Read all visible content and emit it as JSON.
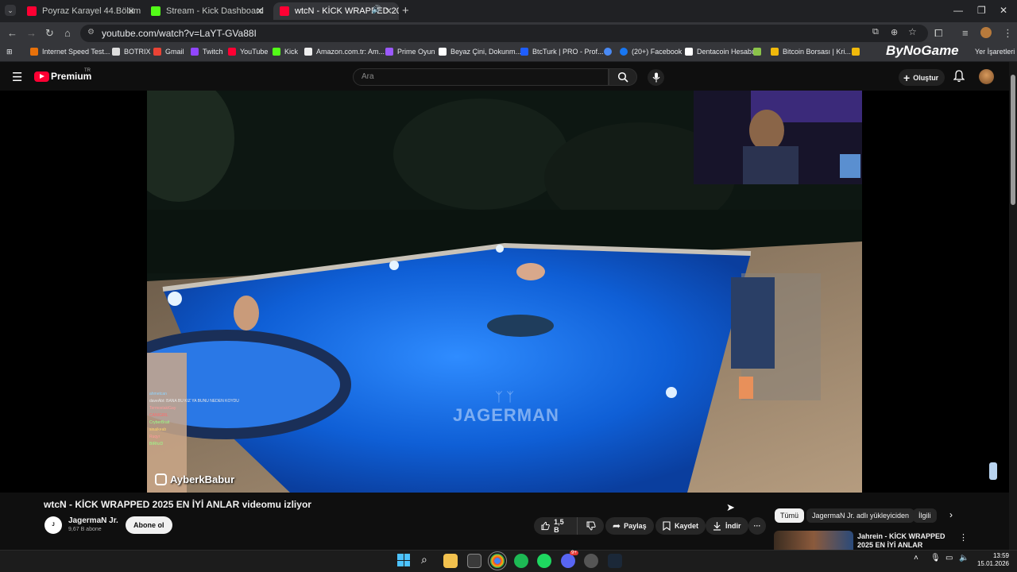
{
  "browser": {
    "tabs": [
      {
        "title": "Poyraz Karayel 44.Bölüm - Full B",
        "active": false
      },
      {
        "title": "Stream - Kick Dashboard",
        "active": false
      },
      {
        "title": "wtcN - KİCK WRAPPED 202",
        "active": true
      }
    ],
    "url": "youtube.com/watch?v=LaYT-GVa88I",
    "bookmarks": [
      "Internet Speed Test...",
      "BOTRIX",
      "Gmail",
      "Twitch",
      "YouTube",
      "Kick",
      "Amazon.com.tr: Am...",
      "Prime Oyun",
      "Beyaz Çini, Dokunm...",
      "BtcTurk | PRO - Prof...",
      "(20+) Facebook",
      "Dentacoin Hesabı",
      "Bitcoin Borsası | Kri..."
    ],
    "bookmarks_right": "Yer İşaretleri",
    "ad_banner_text": "ByNoGame"
  },
  "youtube": {
    "logo_text": "Premium",
    "logo_badge": "TR",
    "search_placeholder": "Ara",
    "create_label": "Oluştur",
    "video": {
      "title": "wtcN - KİCK WRAPPED 2025 EN İYİ ANLAR videomu izliyor",
      "watermark_text": "JAGERMAN",
      "overlay_handle": "AyberkBabur",
      "chat_lines": [
        "ahmetcan",
        "daveAbt: BANA BU KIZ YA BUNU NEDEN KOYDU",
        "TermostakiGay",
        "CANIGIRL",
        "CryberBrait",
        "sinaikeab",
        "Ruqyr",
        "BtRhzD"
      ]
    },
    "channel": {
      "name": "JagermaN Jr.",
      "subscribers": "9,67 B abone",
      "subscribe_label": "Abone ol"
    },
    "actions": {
      "likes": "1,5 B",
      "share": "Paylaş",
      "save": "Kaydet",
      "download": "İndir"
    },
    "chips": [
      {
        "label": "Tümü",
        "selected": true
      },
      {
        "label": "JagermaN Jr. adlı yükleyiciden",
        "selected": false
      },
      {
        "label": "İlgili",
        "selected": false
      }
    ],
    "recommended": [
      {
        "title": "Jahrein - KİCK WRAPPED 2025 EN İYİ ANLAR videomu izliyor"
      }
    ]
  },
  "taskbar": {
    "time": "13:59",
    "date": "15.01.2026",
    "discord_badge": "9+"
  }
}
